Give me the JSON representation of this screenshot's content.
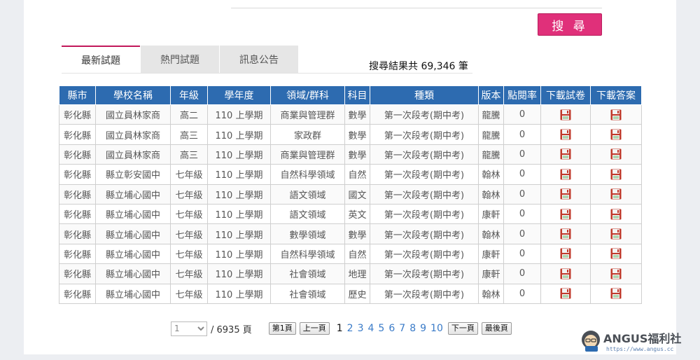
{
  "search": {
    "button_label": "搜 尋"
  },
  "tabs": [
    {
      "label": "最新試題",
      "active": true
    },
    {
      "label": "熱門試題",
      "active": false
    },
    {
      "label": "訊息公告",
      "active": false
    }
  ],
  "result_summary": "搜尋結果共 69,346 筆",
  "table": {
    "headers": [
      "縣市",
      "學校名稱",
      "年級",
      "學年度",
      "領域/群科",
      "科目",
      "種類",
      "版本",
      "點閱率",
      "下載試卷",
      "下載答案"
    ],
    "rows": [
      [
        "彰化縣",
        "國立員林家商",
        "高二",
        "110 上學期",
        "商業與管理群",
        "數學",
        "第一次段考(期中考)",
        "龍騰",
        "0"
      ],
      [
        "彰化縣",
        "國立員林家商",
        "高三",
        "110 上學期",
        "家政群",
        "數學",
        "第一次段考(期中考)",
        "龍騰",
        "0"
      ],
      [
        "彰化縣",
        "國立員林家商",
        "高三",
        "110 上學期",
        "商業與管理群",
        "數學",
        "第一次段考(期中考)",
        "龍騰",
        "0"
      ],
      [
        "彰化縣",
        "縣立彰安國中",
        "七年級",
        "110 上學期",
        "自然科學領域",
        "自然",
        "第一次段考(期中考)",
        "翰林",
        "0"
      ],
      [
        "彰化縣",
        "縣立埔心國中",
        "七年級",
        "110 上學期",
        "語文領域",
        "國文",
        "第一次段考(期中考)",
        "翰林",
        "0"
      ],
      [
        "彰化縣",
        "縣立埔心國中",
        "七年級",
        "110 上學期",
        "語文領域",
        "英文",
        "第一次段考(期中考)",
        "康軒",
        "0"
      ],
      [
        "彰化縣",
        "縣立埔心國中",
        "七年級",
        "110 上學期",
        "數學領域",
        "數學",
        "第一次段考(期中考)",
        "翰林",
        "0"
      ],
      [
        "彰化縣",
        "縣立埔心國中",
        "七年級",
        "110 上學期",
        "自然科學領域",
        "自然",
        "第一次段考(期中考)",
        "康軒",
        "0"
      ],
      [
        "彰化縣",
        "縣立埔心國中",
        "七年級",
        "110 上學期",
        "社會領域",
        "地理",
        "第一次段考(期中考)",
        "康軒",
        "0"
      ],
      [
        "彰化縣",
        "縣立埔心國中",
        "七年級",
        "110 上學期",
        "社會領域",
        "歷史",
        "第一次段考(期中考)",
        "翰林",
        "0"
      ]
    ],
    "download_icon": "save-icon"
  },
  "pagination": {
    "select_value": "1",
    "total_label": "/ 6935 頁",
    "first_label": "第1頁",
    "prev_label": "上一頁",
    "pages": [
      "1",
      "2",
      "3",
      "4",
      "5",
      "6",
      "7",
      "8",
      "9",
      "10"
    ],
    "current_page": "1",
    "next_label": "下一頁",
    "last_label": "最後頁"
  },
  "watermark": {
    "brand": "ANGUS福利社",
    "url": "https://www.angus.cc"
  },
  "colors": {
    "header_blue": "#2d6bb0",
    "search_pink": "#e0307a",
    "tab_accent": "#c2185b",
    "link_blue": "#3a7bc8"
  }
}
